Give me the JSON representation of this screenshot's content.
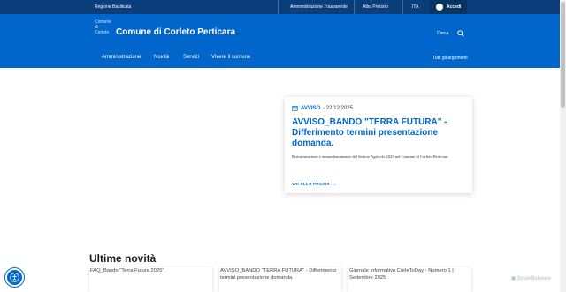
{
  "topbar": {
    "region": "Regione Basilicata",
    "links": [
      "Amministrazione Trasparente",
      "Albo Pretorio"
    ],
    "language": "ITA",
    "login_label": "Accedi"
  },
  "header": {
    "logo_alt": "Comune di Corleto",
    "site_title": "Comune di Corleto Perticara",
    "search_label": "Cerca"
  },
  "nav": {
    "items": [
      "Amministrazione",
      "Novità",
      "Servizi",
      "Vivere il comune"
    ],
    "topics": "Tutti gli argomenti"
  },
  "hero": {
    "category": "AVVISO",
    "date": "- 22/12/2025",
    "title": "AVVISO_BANDO \"TERRA FUTURA\" - Differimento termini presentazione domanda.",
    "description": "Ristrutturazione e ammodernamento del Settore Agricolo 2025 nel Comune di Corleto Perticara.",
    "more_label": "VAI ALLA PAGINA"
  },
  "news": {
    "title": "Ultime novità",
    "items": [
      "FAQ_Bando \"Terra Futura 2025\"",
      "AVVISO_BANDO \"TERRA FUTURA\" - Differimento termini presentazione domanda.",
      "Giornale Informativo CorleToDay - Numero 1 | Settembre 2025"
    ]
  },
  "watermark": "ScanMalware",
  "colors": {
    "primary": "#0066cc",
    "dark": "#0a3d7a"
  }
}
